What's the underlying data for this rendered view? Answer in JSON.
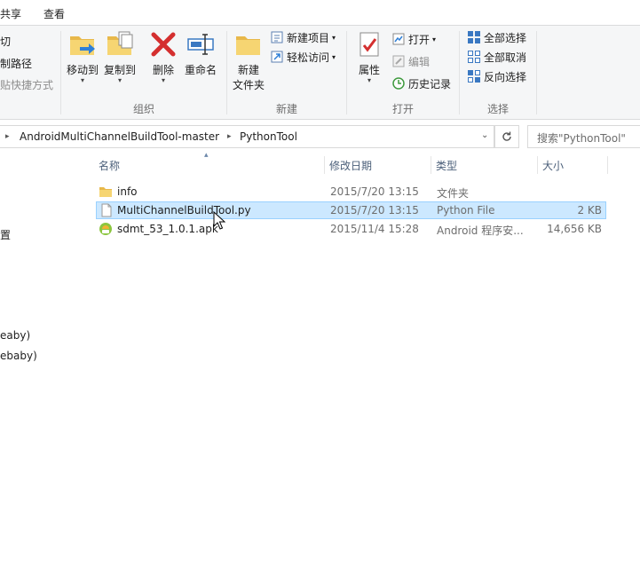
{
  "tabs": [
    "共享",
    "查看"
  ],
  "ribbon": {
    "clipboard": {
      "cut": "切",
      "copy_path": "制路径",
      "paste_shortcut": "贴快捷方式"
    },
    "organize": {
      "label": "组织",
      "move_to": "移动到",
      "copy_to": "复制到",
      "delete": "删除",
      "rename": "重命名"
    },
    "new": {
      "label": "新建",
      "new_folder_line1": "新建",
      "new_folder_line2": "文件夹",
      "new_item": "新建项目",
      "easy_access": "轻松访问"
    },
    "open": {
      "label": "打开",
      "properties": "属性",
      "open": "打开",
      "edit": "编辑",
      "history": "历史记录"
    },
    "select": {
      "label": "选择",
      "select_all": "全部选择",
      "select_none": "全部取消",
      "invert": "反向选择"
    }
  },
  "address": {
    "crumbs": [
      "AndroidMultiChannelBuildTool-master",
      "PythonTool"
    ],
    "search_placeholder": "搜索\"PythonTool\""
  },
  "nav": {
    "items": [
      "置",
      "eaby)",
      "ebaby)"
    ]
  },
  "columns": {
    "name": "名称",
    "date": "修改日期",
    "type": "类型",
    "size": "大小"
  },
  "files": [
    {
      "name": "info",
      "date": "2015/7/20 13:15",
      "type": "文件夹",
      "size": "",
      "icon": "folder-icon",
      "selected": false
    },
    {
      "name": "MultiChannelBuildTool.py",
      "date": "2015/7/20 13:15",
      "type": "Python File",
      "size": "2 KB",
      "icon": "file-icon",
      "selected": true
    },
    {
      "name": "sdmt_53_1.0.1.apk",
      "date": "2015/11/4 15:28",
      "type": "Android 程序安...",
      "size": "14,656 KB",
      "icon": "apk-icon",
      "selected": false
    }
  ],
  "colors": {
    "selection_bg": "#cce8ff",
    "selection_border": "#99d1ff",
    "header_text": "#4c607a",
    "folder": "#e8b84a"
  }
}
